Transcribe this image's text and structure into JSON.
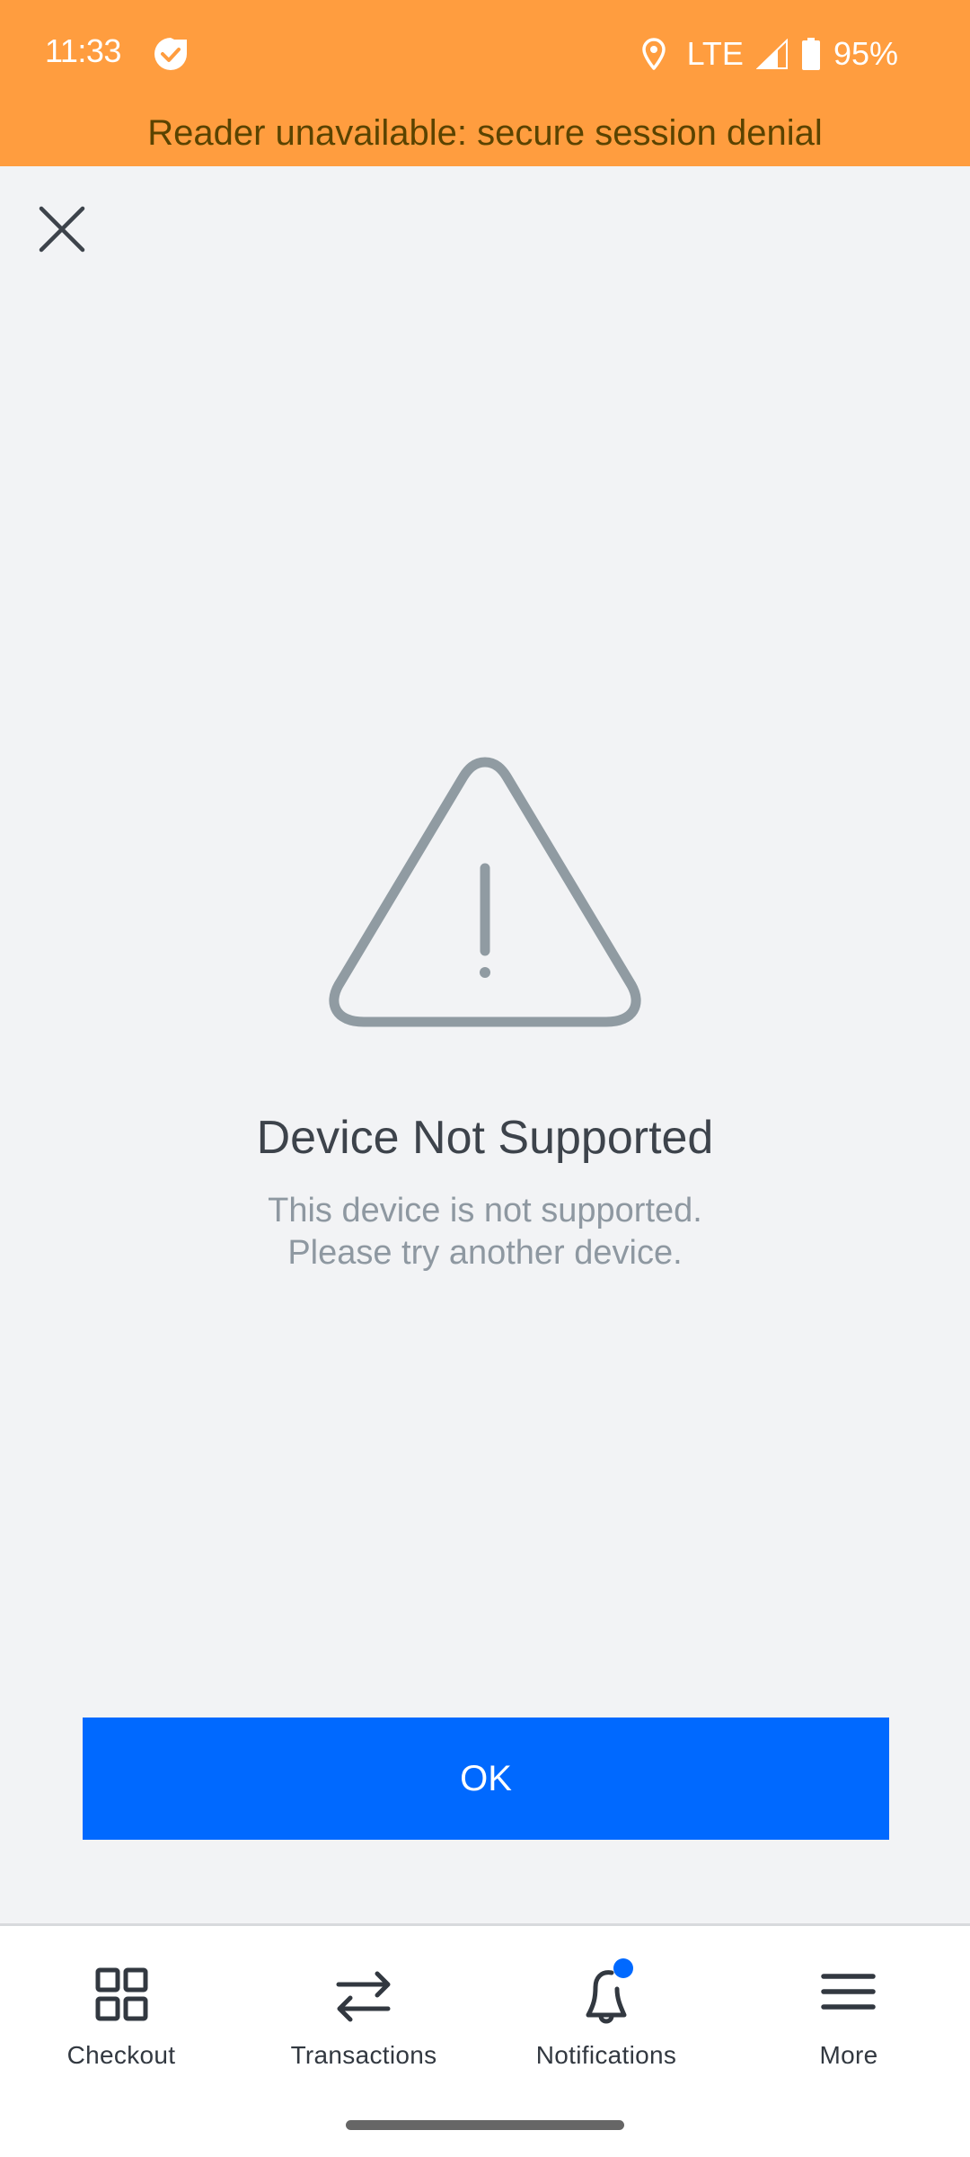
{
  "status_bar": {
    "time": "11:33",
    "app_icon": "app-check-badge-icon",
    "network": "LTE",
    "battery": "95%",
    "icons": [
      "location-icon",
      "signal-icon",
      "battery-icon"
    ]
  },
  "banner": {
    "text": "Reader unavailable: secure session denial",
    "background": "#ff9d3f",
    "text_color": "#5a4300"
  },
  "header": {
    "close_icon": "close-icon"
  },
  "error": {
    "icon": "warning-triangle-icon",
    "title": "Device Not Supported",
    "message_line1": "This device is not supported.",
    "message_line2": "Please try another device."
  },
  "actions": {
    "ok_label": "OK",
    "accent": "#0069ff"
  },
  "bottom_nav": {
    "items": [
      {
        "label": "Checkout",
        "icon": "grid-icon"
      },
      {
        "label": "Transactions",
        "icon": "swap-arrows-icon"
      },
      {
        "label": "Notifications",
        "icon": "bell-icon",
        "has_badge": true
      },
      {
        "label": "More",
        "icon": "menu-icon"
      }
    ]
  }
}
